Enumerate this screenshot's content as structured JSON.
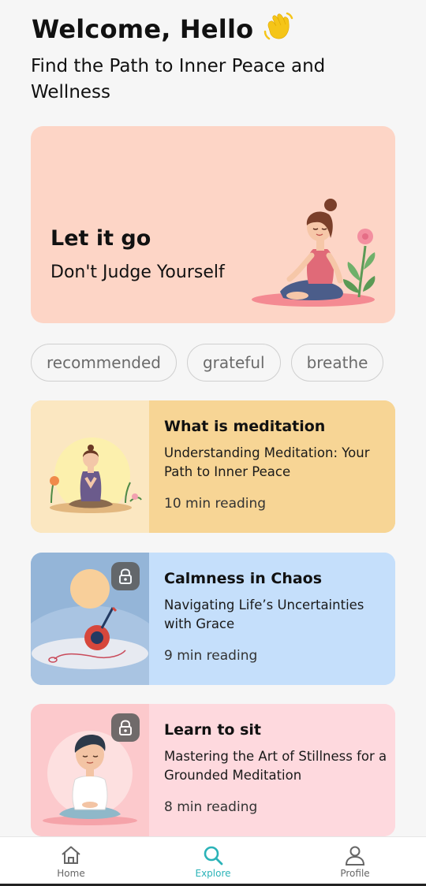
{
  "header": {
    "greeting": "Welcome, Hello",
    "subtitle": "Find the Path to Inner Peace and Wellness",
    "icon": "waving-hand-icon"
  },
  "hero": {
    "title": "Let it go",
    "subtitle": "Don't Judge Yourself",
    "background": "#fdd5c6"
  },
  "chips": [
    {
      "label": "recommended"
    },
    {
      "label": "grateful"
    },
    {
      "label": "breathe"
    }
  ],
  "cards": [
    {
      "title": "What is meditation",
      "description": "Understanding Meditation: Your Path to Inner Peace",
      "time": "10 min reading",
      "color": "#f7d595",
      "thumb_color": "#fbe7c1",
      "locked": false
    },
    {
      "title": "Calmness in Chaos",
      "description": "Navigating Life’s Uncertainties with Grace",
      "time": "9 min reading",
      "color": "#c5dffb",
      "thumb_color": "#94b5d8",
      "locked": true
    },
    {
      "title": "Learn to sit",
      "description": "Mastering the Art of Stillness for a Grounded Meditation",
      "time": "8 min reading",
      "color": "#fed9de",
      "thumb_color": "#fcc9cc",
      "locked": true
    }
  ],
  "nav": {
    "items": [
      {
        "label": "Home",
        "icon": "home-icon",
        "active": false
      },
      {
        "label": "Explore",
        "icon": "search-icon",
        "active": true
      },
      {
        "label": "Profile",
        "icon": "profile-icon",
        "active": false
      }
    ],
    "active_color": "#2bb3b8"
  }
}
